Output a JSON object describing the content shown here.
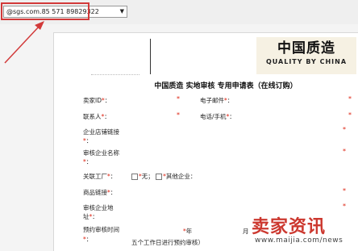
{
  "contact_select": {
    "value": "@sgs.com.85 571 89829322"
  },
  "brand": {
    "name_cn": "中国质造",
    "name_en": "QUALITY BY CHINA",
    "logo_mark": "quality-by-china-logo"
  },
  "form": {
    "title": "中国质造 实地审核 专用申请表（在线订购）",
    "fields": {
      "seller_id": "卖家ID",
      "email": "电子邮件",
      "contact_person": "联系人",
      "phone": "电话/手机",
      "shop_link_1": "企业店铺链接",
      "shop_link_2": "：",
      "company_name_1": "审核企业名称",
      "company_name_2": "：",
      "related_factory": "关联工厂",
      "none_option": "无；",
      "other_company": "其他企业：",
      "product_link": "商品链接",
      "address_1": "审核企业地",
      "address_2": "址",
      "schedule_1": "预约审核时间",
      "schedule_2": "：",
      "year": "年",
      "month": "月",
      "notice": "五个工作日进行预约审核）"
    }
  },
  "watermark": {
    "text": "卖家资讯",
    "url": "www.maijia.com/news"
  },
  "colors": {
    "accent_red": "#d23a3a",
    "required_star": "#d21111",
    "brand_bg": "#f6f1e3"
  }
}
